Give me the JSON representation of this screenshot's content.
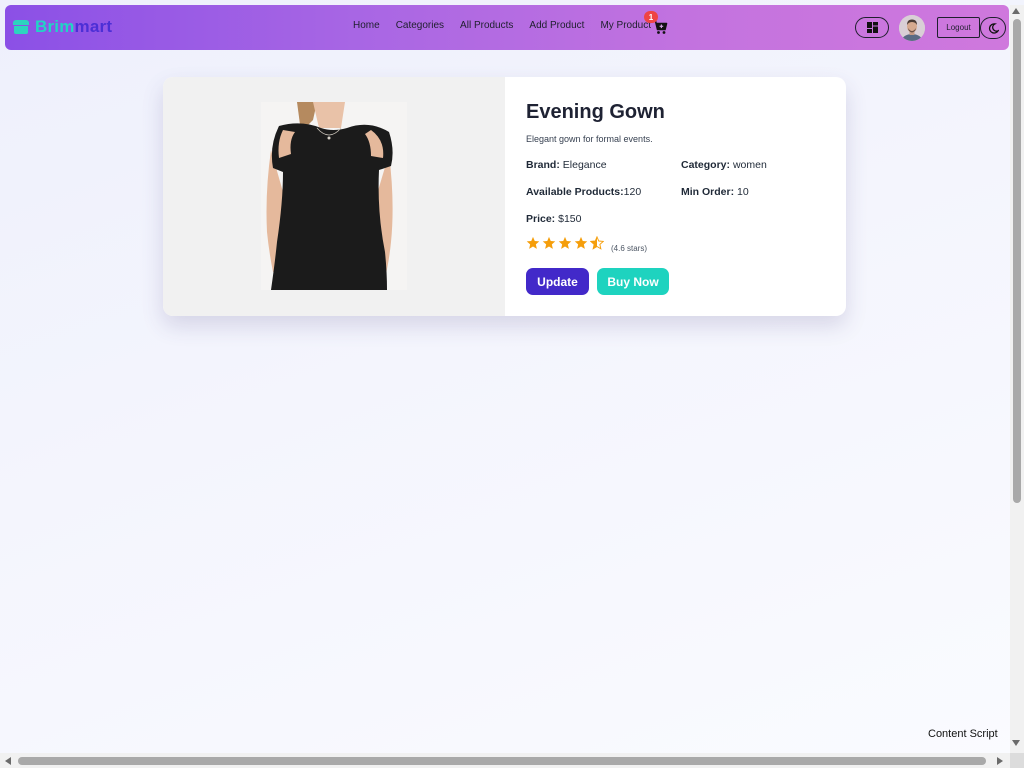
{
  "navbar": {
    "brand_part1": "Brim",
    "brand_part2": "mart",
    "brand_icon": "store-icon",
    "links": [
      {
        "label": "Home"
      },
      {
        "label": "Categories"
      },
      {
        "label": "All Products"
      },
      {
        "label": "Add Product"
      },
      {
        "label": "My Product"
      }
    ],
    "cart_badge": "1",
    "cart_icon": "cart-icon",
    "dashboard_icon": "dashboard-icon",
    "logout_label": "Logout",
    "theme_icon": "moon-icon",
    "colors": {
      "gradient_start": "#8b50e6",
      "gradient_end": "#cf78dd",
      "brand_teal": "#22d3c5",
      "brand_indigo": "#4c2fd6"
    }
  },
  "product": {
    "title": "Evening Gown",
    "description": "Elegant gown for formal events.",
    "brand_key": "Brand:",
    "brand_value": "Elegance",
    "category_key": "Category:",
    "category_value": "women",
    "available_key": "Available Products:",
    "available_value": "120",
    "min_order_key": "Min Order:",
    "min_order_value": "10",
    "price_key": "Price:",
    "price_value": "$150",
    "rating": 4.6,
    "rating_text": "(4.6 stars)",
    "update_label": "Update",
    "buy_label": "Buy Now",
    "colors": {
      "update": "#4229c9",
      "buy": "#1ed3bf",
      "star": "#f59e0b"
    }
  },
  "footer": {
    "content_script": "Content Script"
  }
}
